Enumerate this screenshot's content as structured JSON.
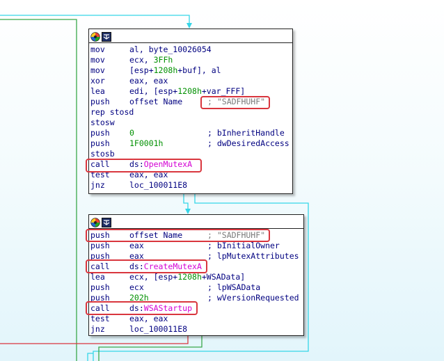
{
  "icons": {
    "color_palette": "color-palette-icon",
    "rename": "graph-overview-icon"
  },
  "colors": {
    "highlight_box": "#d9363e",
    "edge_cyan": "#35d6e8",
    "edge_green": "#3aa84a",
    "edge_red": "#d9363e",
    "number_green": "#009000",
    "import_magenta": "#d400d4",
    "code_navy": "#000080"
  },
  "block1": {
    "lines": [
      {
        "mnemonic": "mov",
        "operand": "al, byte_10026054"
      },
      {
        "mnemonic": "mov",
        "operand_pre": "ecx, ",
        "operand_num": "3FFh"
      },
      {
        "mnemonic": "mov",
        "operand_pre": "[esp+",
        "operand_num": "1208h",
        "operand_post": "+buf], al"
      },
      {
        "mnemonic": "xor",
        "operand": "eax, eax"
      },
      {
        "mnemonic": "lea",
        "operand_pre": "edi, [esp+",
        "operand_num": "1208h",
        "operand_post": "+var_FFF]"
      },
      {
        "mnemonic": "push",
        "operand": "offset Name",
        "comment": "; \"SADFHUHF\""
      },
      {
        "mnemonic": "rep stosd",
        "operand": ""
      },
      {
        "mnemonic": "stosw",
        "operand": ""
      },
      {
        "mnemonic": "push",
        "operand_num": "0",
        "comment": "; bInheritHandle"
      },
      {
        "mnemonic": "push",
        "operand_num": "1F0001h",
        "comment": "; dwDesiredAccess"
      },
      {
        "mnemonic": "stosb",
        "operand": ""
      },
      {
        "mnemonic": "call",
        "operand_pre": "ds:",
        "operand_fn": "OpenMutexA"
      },
      {
        "mnemonic": "test",
        "operand": "eax, eax"
      },
      {
        "mnemonic": "jnz",
        "operand": "loc_100011E8"
      }
    ]
  },
  "block2": {
    "lines": [
      {
        "mnemonic": "push",
        "operand": "offset Name",
        "comment": "; \"SADFHUHF\""
      },
      {
        "mnemonic": "push",
        "operand": "eax",
        "comment": "; bInitialOwner"
      },
      {
        "mnemonic": "push",
        "operand": "eax",
        "comment": "; lpMutexAttributes"
      },
      {
        "mnemonic": "call",
        "operand_pre": "ds:",
        "operand_fn": "CreateMutexA"
      },
      {
        "mnemonic": "lea",
        "operand_pre": "ecx, [esp+",
        "operand_num": "1208h",
        "operand_post": "+WSAData]"
      },
      {
        "mnemonic": "push",
        "operand": "ecx",
        "comment": "; lpWSAData"
      },
      {
        "mnemonic": "push",
        "operand_num": "202h",
        "comment": "; wVersionRequested"
      },
      {
        "mnemonic": "call",
        "operand_pre": "ds:",
        "operand_fn": "WSAStartup"
      },
      {
        "mnemonic": "test",
        "operand": "eax, eax"
      },
      {
        "mnemonic": "jnz",
        "operand": "loc_100011E8"
      }
    ]
  }
}
